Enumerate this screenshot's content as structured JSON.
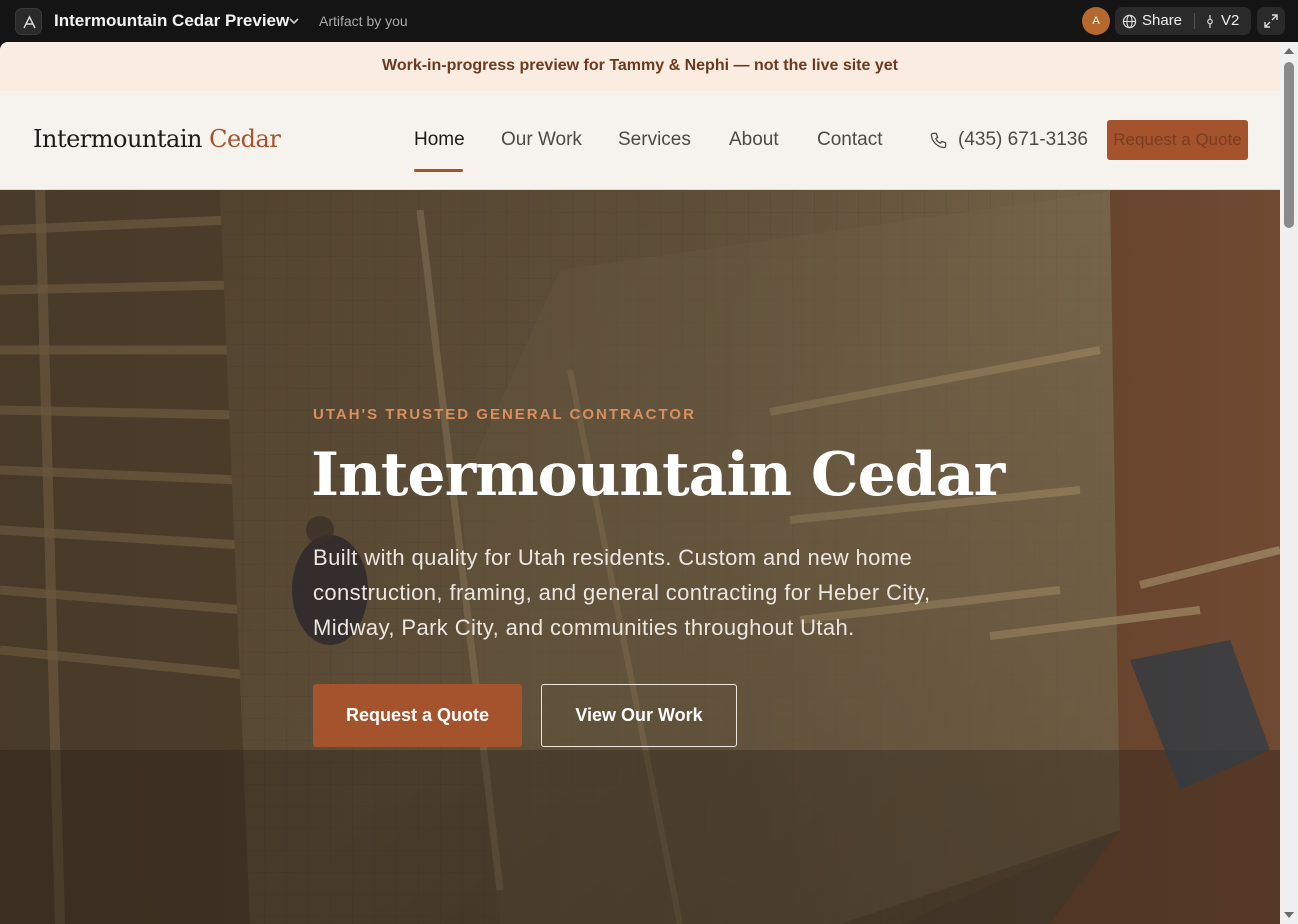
{
  "app": {
    "title": "Intermountain Cedar Preview",
    "subtitle": "Artifact by you",
    "avatar_initial": "A",
    "share_label": "Share",
    "version_label": "V2",
    "avatar_color": "#b5692e"
  },
  "site": {
    "banner": "Work-in-progress preview for Tammy & Nephi — not the live site yet",
    "logo": {
      "main": "Intermountain ",
      "accent": "Cedar"
    },
    "nav": {
      "items": [
        {
          "label": "Home",
          "active": true
        },
        {
          "label": "Our Work",
          "active": false
        },
        {
          "label": "Services",
          "active": false
        },
        {
          "label": "About",
          "active": false
        },
        {
          "label": "Contact",
          "active": false
        }
      ],
      "phone": "(435) 671-3136",
      "quote_button": "Request a Quote"
    },
    "hero": {
      "kicker": "UTAH'S TRUSTED GENERAL CONTRACTOR",
      "title": "Intermountain Cedar",
      "description": "Built with quality for Utah residents. Custom and new home construction, framing, and general contracting for Heber City, Midway, Park City, and communities throughout Utah.",
      "primary_button": "Request a Quote",
      "secondary_button": "View Our Work"
    },
    "colors": {
      "accent": "#a5532c",
      "banner_bg": "#fbece1",
      "nav_bg": "#f6f3ef"
    }
  },
  "icons": [
    "app-logo-icon",
    "chevron-down-icon",
    "globe-icon",
    "branch-icon",
    "expand-icon",
    "phone-icon"
  ]
}
